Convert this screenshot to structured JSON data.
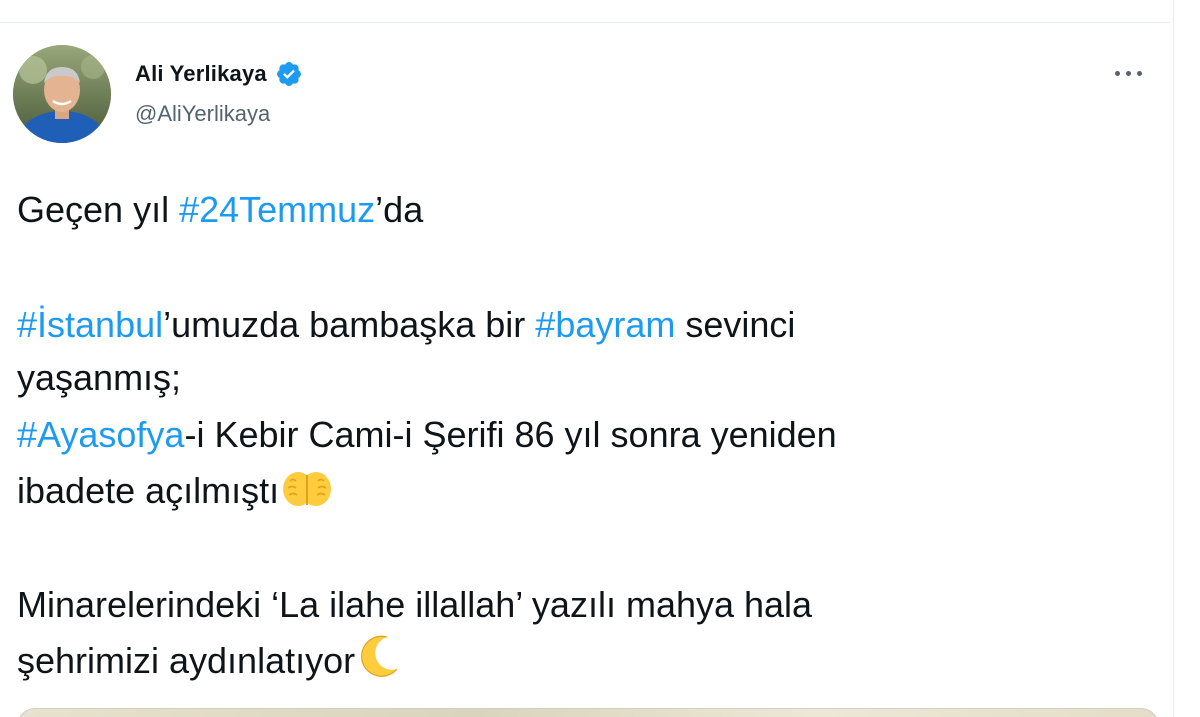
{
  "author": {
    "display_name": "Ali Yerlikaya",
    "handle": "@AliYerlikaya",
    "verified": true
  },
  "tweet": {
    "line1": {
      "t1": "Geçen yıl ",
      "h1": "#24Temmuz",
      "t2": "’da"
    },
    "line2": {
      "h1": "#İstanbul",
      "t1": "’umuzda bambaşka bir ",
      "h2": "#bayram",
      "t2": " sevinci"
    },
    "line3": {
      "t1": "yaşanmış;"
    },
    "line4": {
      "h1": "#Ayasofya",
      "t1": "-i Kebir Cami-i Şerifi 86 yıl sonra yeniden"
    },
    "line5": {
      "t1": "ibadete açılmıştı"
    },
    "line6": {
      "t1": "Minarelerindeki ‘La ilahe illallah’ yazılı mahya hala"
    },
    "line7": {
      "t1": "şehrimizi aydınlatıyor"
    }
  },
  "icons": {
    "verified": "verified-badge-icon",
    "more": "more-dots-icon",
    "praying_hands": "praying-hands-emoji",
    "crescent_moon": "crescent-moon-emoji"
  },
  "colors": {
    "text": "#0f1419",
    "secondary": "#536471",
    "link": "#1d9bf0",
    "verified": "#1d9bf0"
  }
}
